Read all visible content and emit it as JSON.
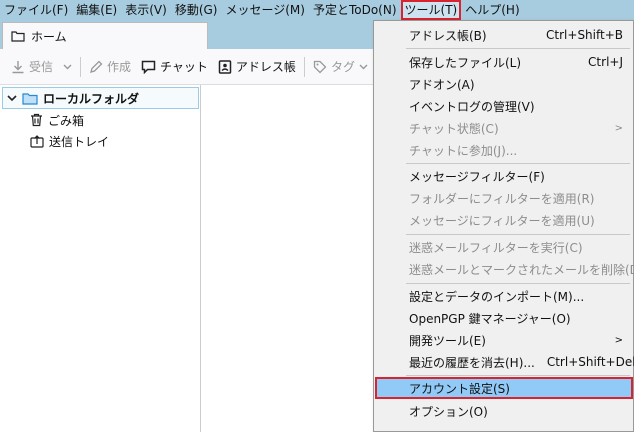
{
  "menubar": {
    "items": [
      {
        "label": "ファイル(F)"
      },
      {
        "label": "編集(E)"
      },
      {
        "label": "表示(V)"
      },
      {
        "label": "移動(G)"
      },
      {
        "label": "メッセージ(M)"
      },
      {
        "label": "予定とToDo(N)"
      },
      {
        "label": "ツール(T)"
      },
      {
        "label": "ヘルプ(H)"
      }
    ]
  },
  "tab": {
    "label": "ホーム",
    "icon": "folder-icon"
  },
  "toolbar": {
    "receive": "受信",
    "compose": "作成",
    "chat": "チャット",
    "addressbook": "アドレス帳",
    "tag": "タグ"
  },
  "folders": {
    "root": "ローカルフォルダ",
    "trash": "ごみ箱",
    "outbox": "送信トレイ"
  },
  "tools_menu": {
    "items": [
      {
        "label": "アドレス帳(B)",
        "shortcut": "Ctrl+Shift+B"
      },
      {
        "label": "保存したファイル(L)",
        "shortcut": "Ctrl+J"
      },
      {
        "label": "アドオン(A)",
        "shortcut": ""
      },
      {
        "label": "イベントログの管理(V)",
        "shortcut": ""
      },
      {
        "label": "チャット状態(C)",
        "shortcut": ""
      },
      {
        "label": "チャットに参加(J)...",
        "shortcut": ""
      },
      {
        "label": "メッセージフィルター(F)",
        "shortcut": ""
      },
      {
        "label": "フォルダーにフィルターを適用(R)",
        "shortcut": ""
      },
      {
        "label": "メッセージにフィルターを適用(U)",
        "shortcut": ""
      },
      {
        "label": "迷惑メールフィルターを実行(C)",
        "shortcut": ""
      },
      {
        "label": "迷惑メールとマークされたメールを削除(D)",
        "shortcut": ""
      },
      {
        "label": "設定とデータのインポート(M)...",
        "shortcut": ""
      },
      {
        "label": "OpenPGP 鍵マネージャー(O)",
        "shortcut": ""
      },
      {
        "label": "開発ツール(E)",
        "shortcut": ""
      },
      {
        "label": "最近の履歴を消去(H)...",
        "shortcut": "Ctrl+Shift+Del"
      },
      {
        "label": "アカウント設定(S)",
        "shortcut": ""
      },
      {
        "label": "オプション(O)",
        "shortcut": ""
      }
    ]
  },
  "colors": {
    "menubar_bg": "#a8ccdf",
    "highlight": "#91c9f7",
    "annotation_red": "#d9232e"
  }
}
